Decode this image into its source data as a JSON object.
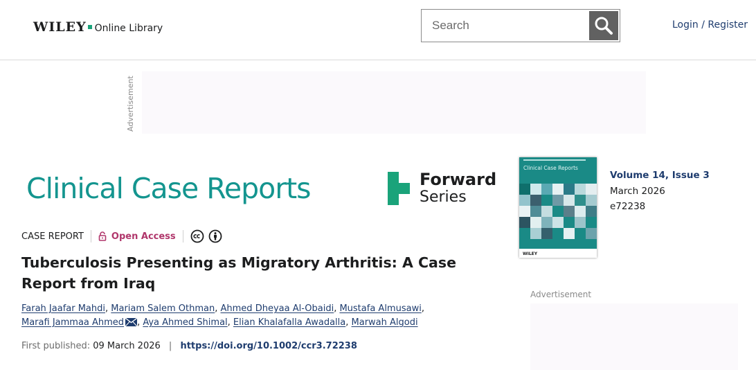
{
  "header": {
    "logo_brand": "WILEY",
    "logo_suffix": "Online Library",
    "search_placeholder": "Search",
    "login_label": "Login / Register"
  },
  "ads": {
    "top_label": "Advertisement",
    "side_label": "Advertisement"
  },
  "journal": {
    "title": "Clinical Case Reports",
    "series_line1": "Forward",
    "series_line2": "Series",
    "cover_title": "Clinical Case Reports",
    "cover_publisher": "WILEY"
  },
  "issue": {
    "volume_issue": "Volume 14, Issue 3",
    "date": "March 2026",
    "article_number": "e72238"
  },
  "article": {
    "type": "CASE REPORT",
    "access": "Open Access",
    "title": "Tuberculosis Presenting as Migratory Arthritis: A Case Report from Iraq",
    "authors": [
      "Farah Jaafar Mahdi",
      "Mariam Salem Othman",
      "Ahmed Dheyaa Al-Obaidi",
      "Mustafa Almusawi",
      "Marafi Jammaa Ahmed",
      "Aya Ahmed Shimal",
      "Elian Khalafalla Awadalla",
      "Marwah Algodi"
    ],
    "first_published_label": "First published:",
    "first_published_date": "09 March 2026",
    "doi": "https://doi.org/10.1002/ccr3.72238"
  },
  "colors": {
    "journal_teal": "#14958f",
    "brand_green": "#1aa37a",
    "link_blue": "#1e3c6e",
    "open_access": "#b0366b"
  },
  "icons": [
    "search-icon",
    "lock-icon",
    "cc-icon",
    "by-icon",
    "mail-icon"
  ]
}
